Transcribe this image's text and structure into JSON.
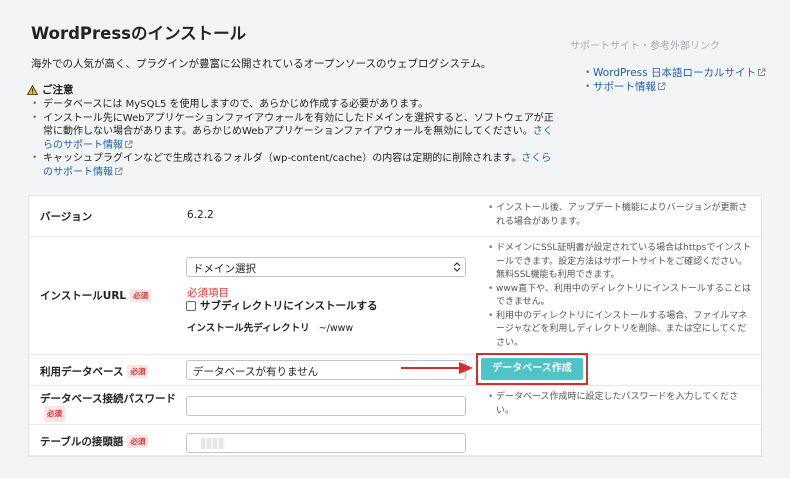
{
  "page": {
    "title": "WordPressのインストール",
    "lead": "海外での人気が高く、プラグインが豊富に公開されているオープンソースのウェブログシステム。"
  },
  "notice": {
    "heading": "ご注意",
    "items": [
      {
        "text": "データベースには MySQL5 を使用しますので、あらかじめ作成する必要があります。",
        "link": ""
      },
      {
        "text": "インストール先にWebアプリケーションファイアウォールを有効にしたドメインを選択すると、ソフトウェアが正常に動作しない場合があります。あらかじめWebアプリケーションファイアウォールを無効にしてください。",
        "link": "さくらのサポート情報"
      },
      {
        "text": "キャッシュプラグインなどで生成されるフォルダ（wp-content/cache）の内容は定期的に削除されます。",
        "link": "さくらのサポート情報"
      }
    ]
  },
  "side": {
    "heading": "サポートサイト・参考外部リンク",
    "links": [
      "WordPress 日本語ローカルサイト",
      "サポート情報"
    ]
  },
  "form": {
    "required_badge": "必須",
    "version": {
      "label": "バージョン",
      "value": "6.2.2",
      "help": [
        "インストール後、アップデート機能によりバージョンが更新される場合があります。"
      ]
    },
    "url": {
      "label": "インストールURL",
      "select_value": "ドメイン選択",
      "error": "必須項目",
      "subdir_label": "サブディレクトリにインストールする",
      "dir_label": "インストール先ディレクトリ",
      "dir_value": "~/www",
      "help": [
        "ドメインにSSL証明書が設定されている場合はhttpsでインストールできます。設定方法はサポートサイトをご確認ください。無料SSL機能も利用できます。",
        "www直下や、利用中のディレクトリにインストールすることはできません。",
        "利用中のディレクトリにインストールする場合、ファイルマネージャなどを利用しディレクトリを削除、または空にしてください。"
      ]
    },
    "database": {
      "label": "利用データベース",
      "value": "データベースが有りません",
      "button": "データベース作成"
    },
    "db_password": {
      "label": "データベース接続パスワード",
      "value": "",
      "help": [
        "データベース作成時に設定したパスワードを入力してください。"
      ]
    },
    "table_prefix": {
      "label": "テーブルの接頭語"
    }
  },
  "colors": {
    "accent": "#4fc3c6",
    "highlight": "#d32f2f",
    "link": "#1f5fae",
    "required": "#d33333"
  }
}
